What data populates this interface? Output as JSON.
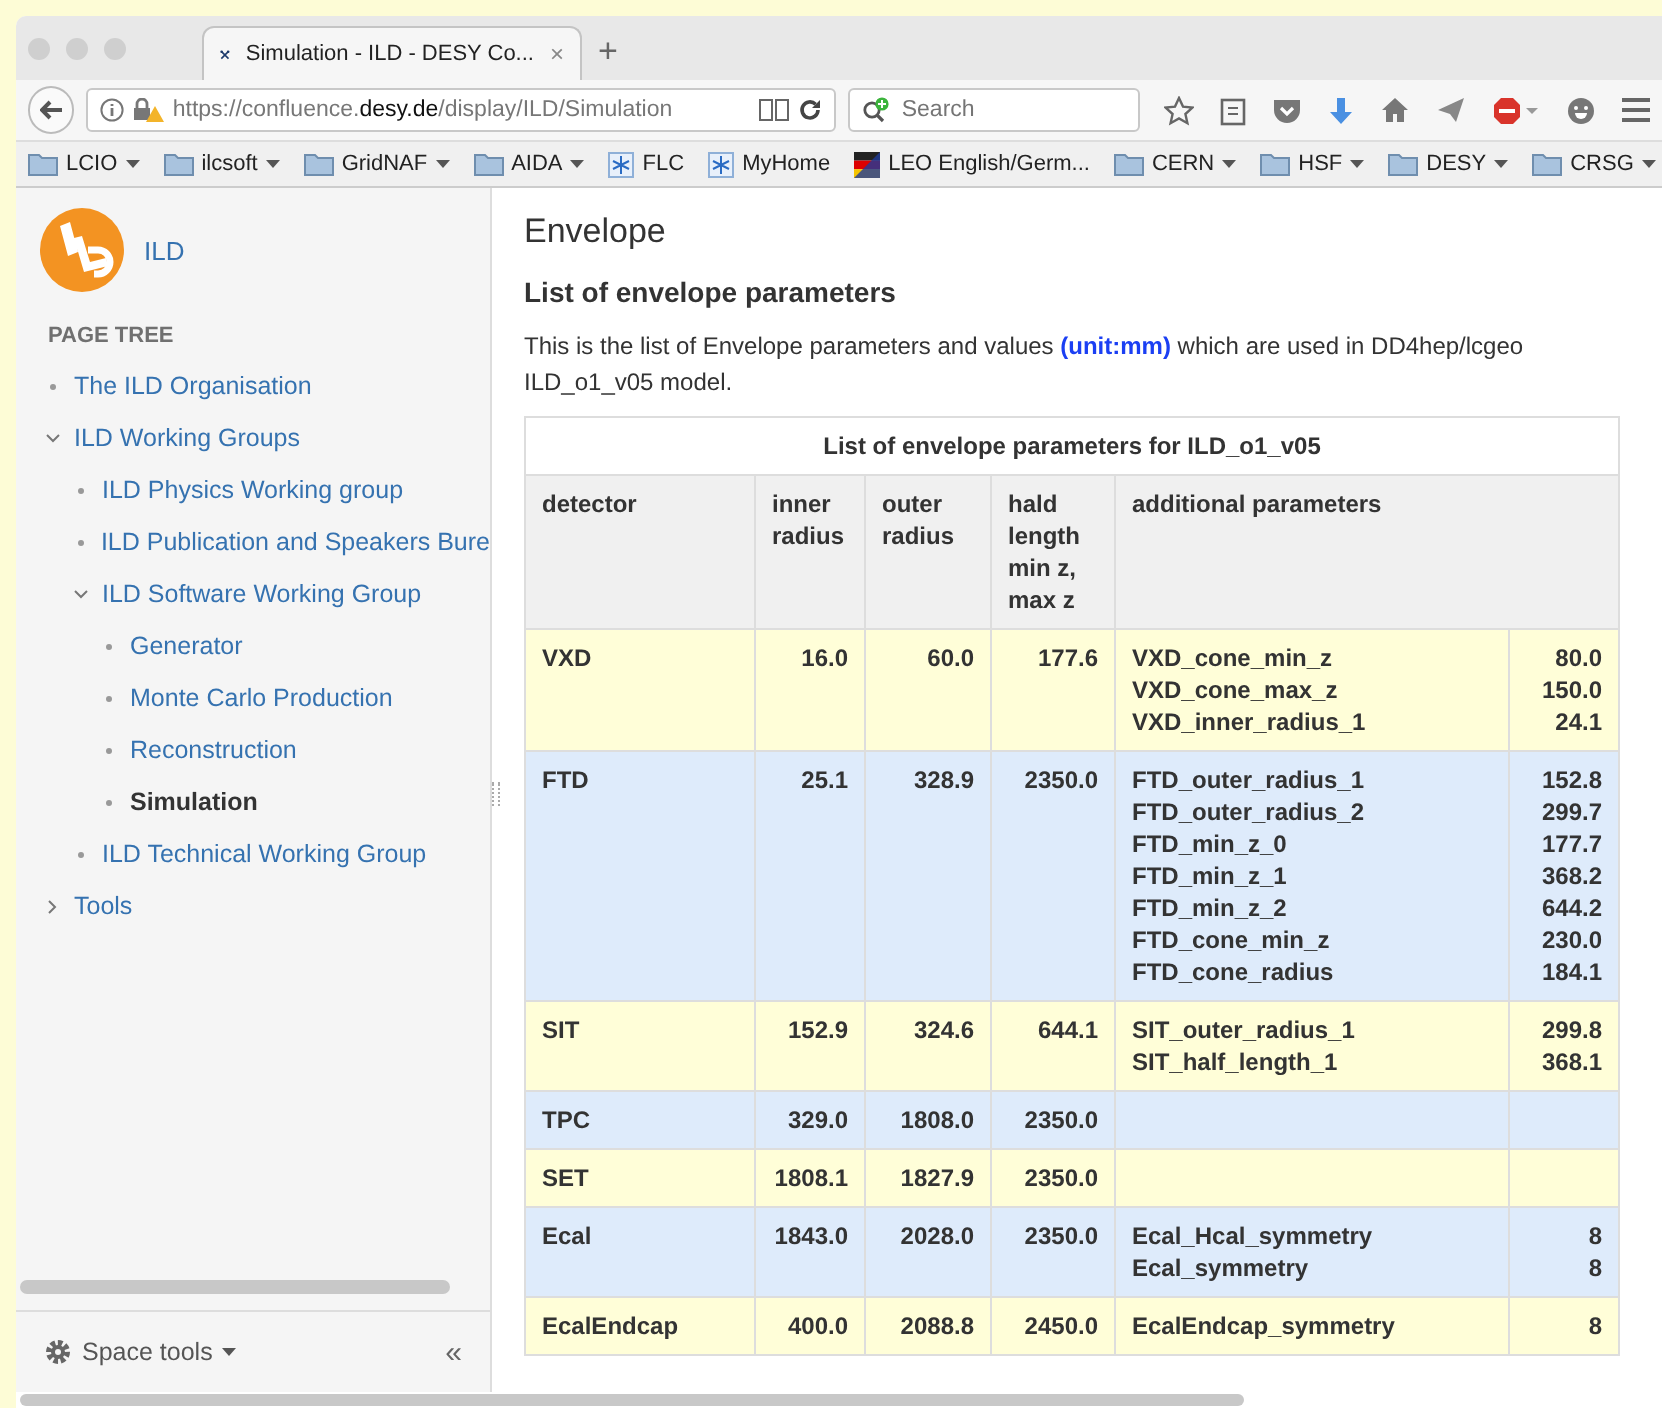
{
  "browser": {
    "tab": {
      "title": "Simulation - ILD - DESY Co...",
      "close": "×"
    },
    "new_tab": "+",
    "url": {
      "scheme": "https://confluence.",
      "host": "desy.de",
      "path": "/display/ILD/Simulation"
    },
    "search": {
      "placeholder": "Search"
    },
    "bookmarks": [
      {
        "label": "LCIO",
        "kind": "folder"
      },
      {
        "label": "ilcsoft",
        "kind": "folder"
      },
      {
        "label": "GridNAF",
        "kind": "folder"
      },
      {
        "label": "AIDA",
        "kind": "folder"
      },
      {
        "label": "FLC",
        "kind": "site"
      },
      {
        "label": "MyHome",
        "kind": "site"
      },
      {
        "label": "LEO English/Germ...",
        "kind": "flag"
      },
      {
        "label": "CERN",
        "kind": "folder"
      },
      {
        "label": "HSF",
        "kind": "folder"
      },
      {
        "label": "DESY",
        "kind": "folder"
      },
      {
        "label": "CRSG",
        "kind": "folder"
      }
    ]
  },
  "sidebar": {
    "space_name": "ILD",
    "section_title": "PAGE TREE",
    "tree": [
      {
        "label": "The ILD Organisation",
        "selected": false
      },
      {
        "label": "ILD Working Groups",
        "selected": false,
        "expanded": true,
        "children": [
          {
            "label": "ILD Physics Working group",
            "selected": false
          },
          {
            "label": "ILD Publication and Speakers Bure",
            "selected": false
          },
          {
            "label": "ILD Software Working Group",
            "selected": false,
            "expanded": true,
            "children": [
              {
                "label": "Generator",
                "selected": false
              },
              {
                "label": "Monte Carlo Production",
                "selected": false
              },
              {
                "label": "Reconstruction",
                "selected": false
              },
              {
                "label": "Simulation",
                "selected": true
              }
            ]
          },
          {
            "label": "ILD Technical Working Group",
            "selected": false
          }
        ]
      },
      {
        "label": "Tools",
        "selected": false,
        "expanded": false
      }
    ],
    "space_tools": "Space tools",
    "collapse": "«"
  },
  "content": {
    "title": "Envelope",
    "heading": "List of envelope parameters",
    "paragraph": "This is the list of Envelope parameters and values **(unit:mm)** which are used in DD4hep/lcgeo ILD_o1_v05 model.",
    "table": {
      "caption": "List of envelope parameters for ILD_o1_v05",
      "columns": [
        "detector",
        "inner radius",
        "outer radius",
        "hald length min z, max z",
        "additional parameters"
      ],
      "rows": [
        {
          "detector": "VXD",
          "inner": "16.0",
          "outer": "60.0",
          "length": "177.6",
          "params": [
            {
              "name": "VXD_cone_min_z",
              "value": "80.0"
            },
            {
              "name": "VXD_cone_max_z",
              "value": "150.0"
            },
            {
              "name": "VXD_inner_radius_1",
              "value": "24.1"
            }
          ]
        },
        {
          "detector": "FTD",
          "inner": "25.1",
          "outer": "328.9",
          "length": "2350.0",
          "params": [
            {
              "name": "FTD_outer_radius_1",
              "value": "152.8"
            },
            {
              "name": "FTD_outer_radius_2",
              "value": "299.7"
            },
            {
              "name": "FTD_min_z_0",
              "value": "177.7"
            },
            {
              "name": "FTD_min_z_1",
              "value": "368.2"
            },
            {
              "name": "FTD_min_z_2",
              "value": "644.2"
            },
            {
              "name": "FTD_cone_min_z",
              "value": "230.0"
            },
            {
              "name": "FTD_cone_radius",
              "value": "184.1"
            }
          ]
        },
        {
          "detector": "SIT",
          "inner": "152.9",
          "outer": "324.6",
          "length": "644.1",
          "params": [
            {
              "name": "SIT_outer_radius_1",
              "value": "299.8"
            },
            {
              "name": "SIT_half_length_1",
              "value": "368.1"
            }
          ]
        },
        {
          "detector": "TPC",
          "inner": "329.0",
          "outer": "1808.0",
          "length": "2350.0"
        },
        {
          "detector": "SET",
          "inner": "1808.1",
          "outer": "1827.9",
          "length": "2350.0"
        },
        {
          "detector": "Ecal",
          "inner": "1843.0",
          "outer": "2028.0",
          "length": "2350.0",
          "params": [
            {
              "name": "Ecal_Hcal_symmetry",
              "value": "8"
            },
            {
              "name": "Ecal_symmetry",
              "value": "8"
            }
          ]
        },
        {
          "detector": "EcalEndcap",
          "inner": "400.0",
          "outer": "2088.8",
          "length": "2450.0",
          "params": [
            {
              "name": "EcalEndcap_symmetry",
              "value": "8"
            }
          ]
        }
      ]
    }
  }
}
